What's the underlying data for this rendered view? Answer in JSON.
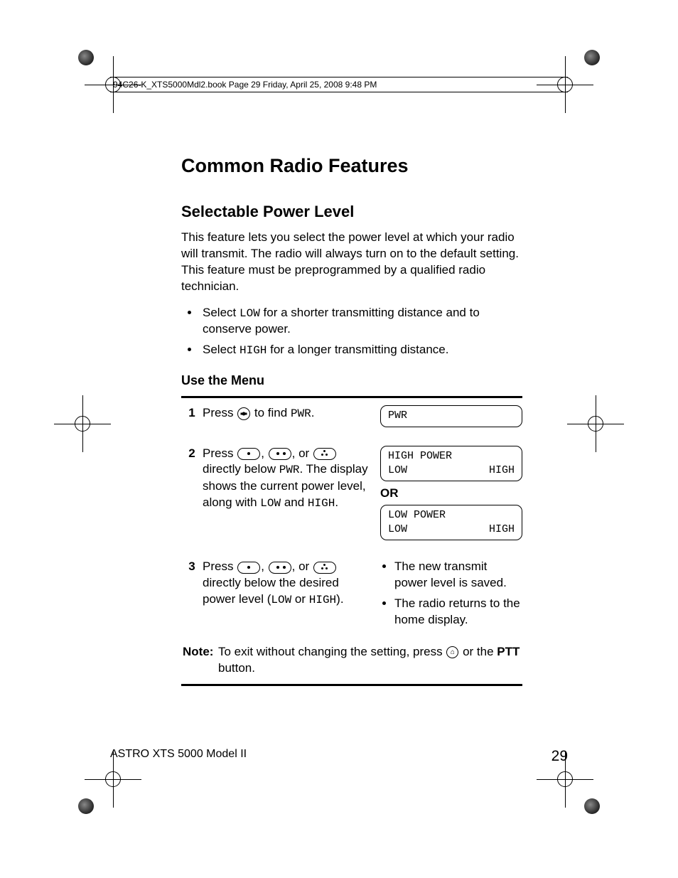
{
  "cropHeader": "94C26-K_XTS5000Mdl2.book  Page 29  Friday, April 25, 2008  9:48 PM",
  "title": "Common Radio Features",
  "section": "Selectable Power Level",
  "intro": "This feature lets you select the power level at which your radio will transmit. The radio will always turn on to the default setting. This feature must be preprogrammed by a qualified radio technician.",
  "bullets": {
    "b1a": "Select ",
    "b1mono": "LOW",
    "b1b": " for a shorter transmitting distance and to conserve power.",
    "b2a": "Select ",
    "b2mono": "HIGH",
    "b2b": " for a longer transmitting distance."
  },
  "subhead": "Use the Menu",
  "steps": {
    "s1": {
      "num": "1",
      "a": "Press ",
      "b": " to find ",
      "mono": "PWR",
      "c": ".",
      "lcd1": "PWR"
    },
    "s2": {
      "num": "2",
      "a": "Press ",
      "b": ", ",
      "c": ", or ",
      "d": " directly below ",
      "mono1": "PWR",
      "e": ". The display shows the current power level, along with ",
      "mono2": "LOW",
      "f": " and ",
      "mono3": "HIGH",
      "g": ".",
      "lcdA_top": "HIGH POWER",
      "lcdA_left": "LOW",
      "lcdA_right": "HIGH",
      "or": "OR",
      "lcdB_top": "LOW POWER",
      "lcdB_left": "LOW",
      "lcdB_right": "HIGH"
    },
    "s3": {
      "num": "3",
      "a": "Press ",
      "b": ", ",
      "c": ", or ",
      "d": " directly below the desired power level (",
      "mono1": "LOW",
      "e": " or ",
      "mono2": "HIGH",
      "f": ").",
      "r1": "The new transmit power level is saved.",
      "r2": "The radio returns to the home display."
    }
  },
  "note": {
    "label": "Note:",
    "a": "To exit without changing the setting, press ",
    "b": " or the ",
    "ptt": "PTT",
    "c": " button."
  },
  "footer": {
    "model": "ASTRO XTS 5000 Model II",
    "page": "29"
  }
}
